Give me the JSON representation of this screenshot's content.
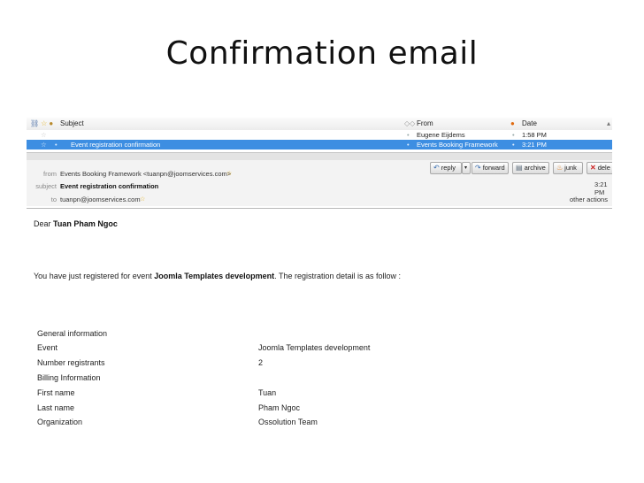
{
  "slide_title": "Confirmation email",
  "list": {
    "columns": {
      "subject": "Subject",
      "from": "From",
      "date": "Date"
    },
    "rows": [
      {
        "subject": "",
        "from": "Eugene Eijdems",
        "date": "1:58 PM",
        "selected": false
      },
      {
        "subject": "Event registration confirmation",
        "from": "Events Booking Framework",
        "date": "3:21 PM",
        "selected": true
      }
    ]
  },
  "message": {
    "from_label": "from",
    "from_value": "Events Booking Framework <tuanpn@joomservices.com>",
    "subject_label": "subject",
    "subject_value": "Event registration confirmation",
    "to_label": "to",
    "to_value": "tuanpn@joomservices.com",
    "time": "3:21 PM",
    "other_actions": "other actions",
    "buttons": {
      "reply": "reply",
      "forward": "forward",
      "archive": "archive",
      "junk": "junk",
      "delete": "dele"
    }
  },
  "email": {
    "greeting_prefix": "Dear ",
    "greeting_name": "Tuan Pham Ngoc",
    "intro_prefix": "You have just registered for event ",
    "intro_event": "Joomla Templates development",
    "intro_suffix": ". The registration detail is as follow :",
    "details": [
      {
        "label": "General information",
        "value": ""
      },
      {
        "label": "Event",
        "value": "Joomla Templates development"
      },
      {
        "label": "Number registrants",
        "value": "2"
      },
      {
        "label": "Billing Information",
        "value": ""
      },
      {
        "label": "First name",
        "value": "Tuan"
      },
      {
        "label": "Last name",
        "value": "Pham Ngoc"
      },
      {
        "label": "Organization",
        "value": "Ossolution Team"
      }
    ]
  },
  "colors": {
    "selected_row": "#3d8ee2",
    "header_bg": "#f3f3f3"
  }
}
